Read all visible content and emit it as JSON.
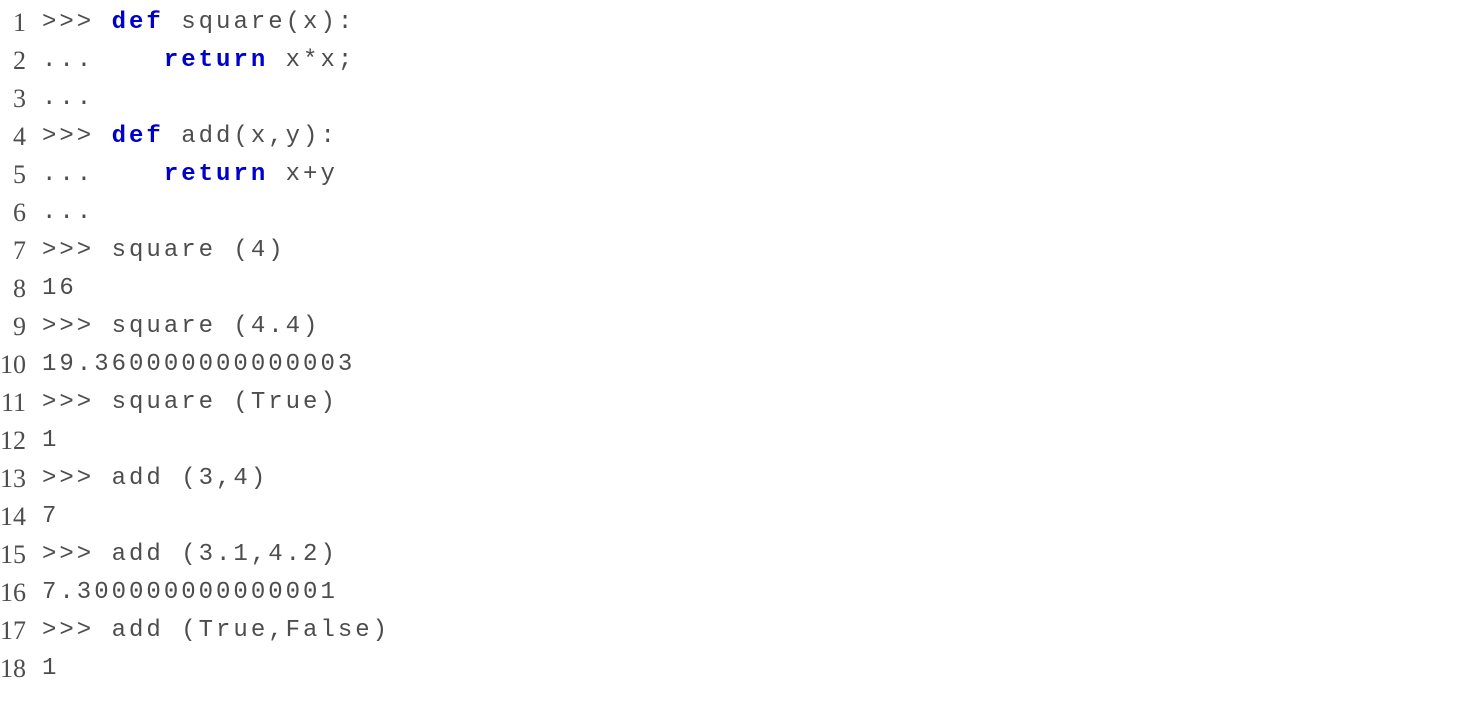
{
  "lineNumbers": [
    "1",
    "2",
    "3",
    "4",
    "5",
    "6",
    "7",
    "8",
    "9",
    "10",
    "11",
    "12",
    "13",
    "14",
    "15",
    "16",
    "17",
    "18"
  ],
  "lines": {
    "l1": {
      "prefix": ">>> ",
      "kw": "def",
      "rest": " square(x):"
    },
    "l2": {
      "prefix": "...    ",
      "kw": "return",
      "rest": " x*x;"
    },
    "l3": {
      "text": "..."
    },
    "l4": {
      "prefix": ">>> ",
      "kw": "def",
      "rest": " add(x,y):"
    },
    "l5": {
      "prefix": "...    ",
      "kw": "return",
      "rest": " x+y"
    },
    "l6": {
      "text": "..."
    },
    "l7": {
      "text": ">>> square (4)"
    },
    "l8": {
      "text": "16"
    },
    "l9": {
      "text": ">>> square (4.4)"
    },
    "l10": {
      "text": "19.360000000000003"
    },
    "l11": {
      "text": ">>> square (True)"
    },
    "l12": {
      "text": "1"
    },
    "l13": {
      "text": ">>> add (3,4)"
    },
    "l14": {
      "text": "7"
    },
    "l15": {
      "text": ">>> add (3.1,4.2)"
    },
    "l16": {
      "text": "7.300000000000001"
    },
    "l17": {
      "text": ">>> add (True,False)"
    },
    "l18": {
      "text": "1"
    }
  }
}
